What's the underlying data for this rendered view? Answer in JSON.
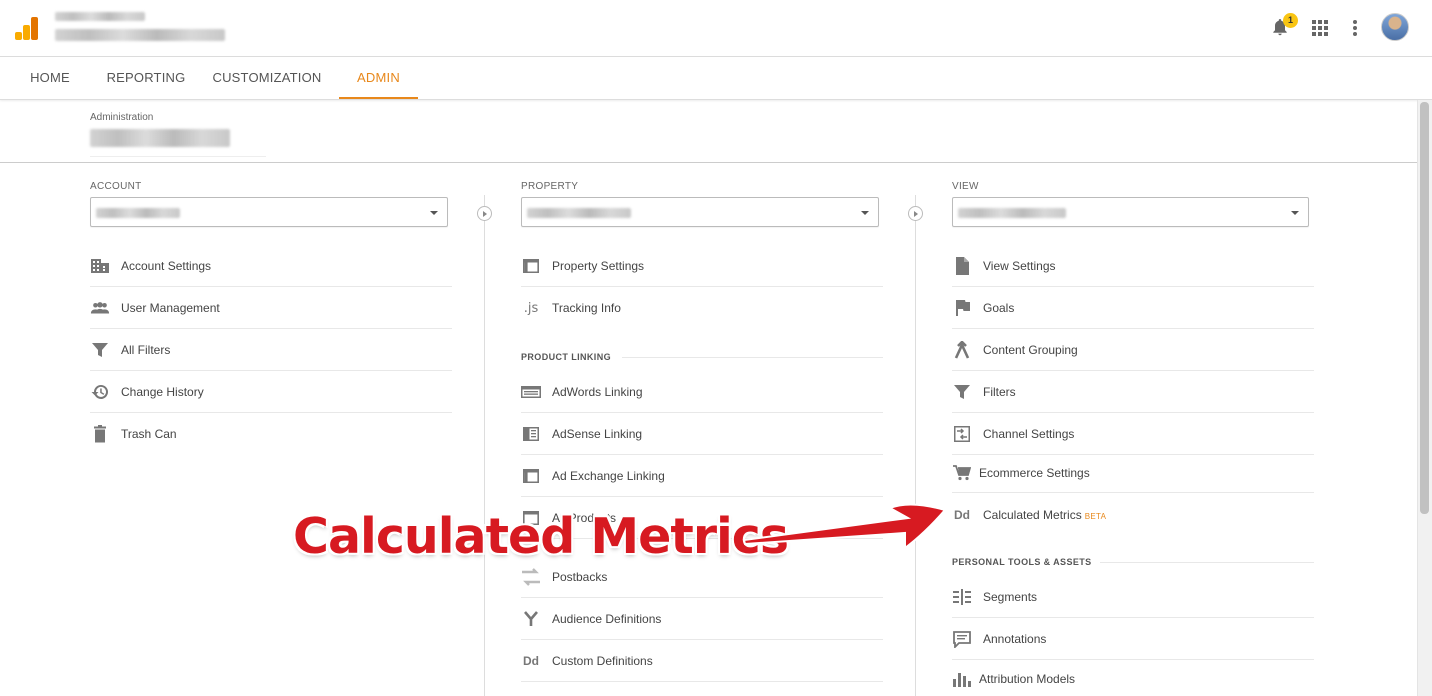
{
  "tabs": [
    "HOME",
    "REPORTING",
    "CUSTOMIZATION",
    "ADMIN"
  ],
  "notification_count": "1",
  "admin": {
    "label": "Administration"
  },
  "account": {
    "header": "ACCOUNT",
    "items": [
      "Account Settings",
      "User Management",
      "All Filters",
      "Change History",
      "Trash Can"
    ]
  },
  "property": {
    "header": "PROPERTY",
    "items_top": [
      "Property Settings",
      "Tracking Info"
    ],
    "section": "PRODUCT LINKING",
    "items_linking": [
      "AdWords Linking",
      "AdSense Linking",
      "Ad Exchange Linking",
      "All Products",
      "Postbacks",
      "Audience Definitions",
      "Custom Definitions"
    ],
    "tracking_icon_text": ".js",
    "dd_icon_text": "Dd"
  },
  "view": {
    "header": "VIEW",
    "items": [
      "View Settings",
      "Goals",
      "Content Grouping",
      "Filters",
      "Channel Settings",
      "Ecommerce Settings",
      "Calculated Metrics"
    ],
    "beta": "BETA",
    "dd_icon_text": "Dd",
    "section": "PERSONAL TOOLS & ASSETS",
    "tools": [
      "Segments",
      "Annotations",
      "Attribution Models"
    ]
  },
  "annotation": {
    "text": "Calculated Metrics"
  },
  "colors": {
    "accent": "#e8881b",
    "annotation": "#d71a21",
    "logo_light": "#f9ab00",
    "logo_dark": "#e37400"
  }
}
